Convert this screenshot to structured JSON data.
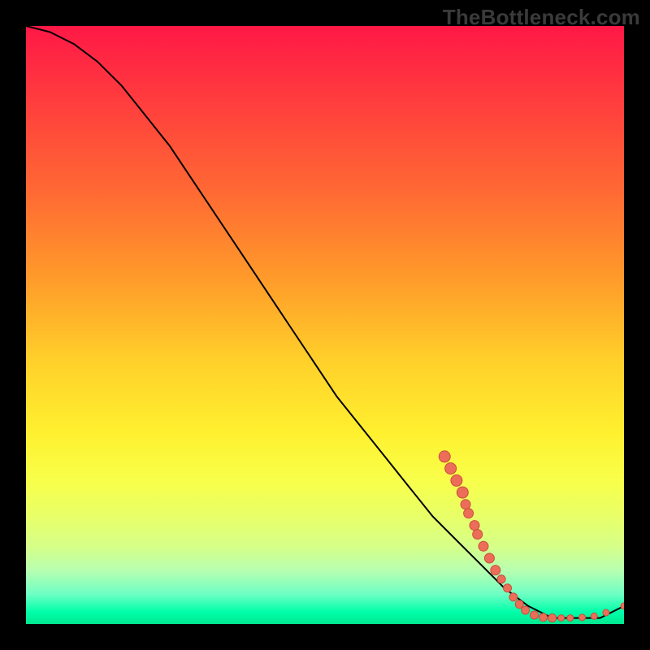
{
  "watermark": "TheBottleneck.com",
  "colors": {
    "background": "#000000",
    "curve": "#000000",
    "dot_fill": "#ec6e59",
    "dot_stroke": "#c94e3c"
  },
  "chart_data": {
    "type": "line",
    "title": "",
    "xlabel": "",
    "ylabel": "",
    "xlim": [
      0,
      100
    ],
    "ylim": [
      0,
      100
    ],
    "series": [
      {
        "name": "curve",
        "x": [
          0,
          4,
          8,
          12,
          16,
          20,
          24,
          28,
          32,
          36,
          40,
          44,
          48,
          52,
          56,
          60,
          64,
          68,
          72,
          76,
          80,
          84,
          88,
          92,
          96,
          100
        ],
        "y": [
          100,
          99,
          97,
          94,
          90,
          85,
          80,
          74,
          68,
          62,
          56,
          50,
          44,
          38,
          33,
          28,
          23,
          18,
          14,
          10,
          6,
          3,
          1,
          1,
          1,
          3
        ]
      }
    ],
    "markers": {
      "name": "dots",
      "points": [
        {
          "x": 70,
          "y": 28,
          "r": 7
        },
        {
          "x": 71,
          "y": 26,
          "r": 7
        },
        {
          "x": 72,
          "y": 24,
          "r": 7
        },
        {
          "x": 73,
          "y": 22,
          "r": 7
        },
        {
          "x": 73.5,
          "y": 20,
          "r": 6
        },
        {
          "x": 74,
          "y": 18.5,
          "r": 6
        },
        {
          "x": 75,
          "y": 16.5,
          "r": 6
        },
        {
          "x": 75.5,
          "y": 15,
          "r": 6
        },
        {
          "x": 76.5,
          "y": 13,
          "r": 6
        },
        {
          "x": 77.5,
          "y": 11,
          "r": 6
        },
        {
          "x": 78.5,
          "y": 9,
          "r": 6
        },
        {
          "x": 79.5,
          "y": 7.5,
          "r": 5
        },
        {
          "x": 80.5,
          "y": 6,
          "r": 5
        },
        {
          "x": 81.5,
          "y": 4.5,
          "r": 5
        },
        {
          "x": 82.5,
          "y": 3.3,
          "r": 5
        },
        {
          "x": 83.5,
          "y": 2.3,
          "r": 5
        },
        {
          "x": 85,
          "y": 1.5,
          "r": 5
        },
        {
          "x": 86.5,
          "y": 1.1,
          "r": 5
        },
        {
          "x": 88,
          "y": 1.0,
          "r": 5
        },
        {
          "x": 89.5,
          "y": 1.0,
          "r": 4
        },
        {
          "x": 91,
          "y": 1.0,
          "r": 4
        },
        {
          "x": 93,
          "y": 1.1,
          "r": 4
        },
        {
          "x": 95,
          "y": 1.3,
          "r": 4
        },
        {
          "x": 97,
          "y": 1.9,
          "r": 4
        },
        {
          "x": 100,
          "y": 3.0,
          "r": 4
        }
      ]
    }
  }
}
